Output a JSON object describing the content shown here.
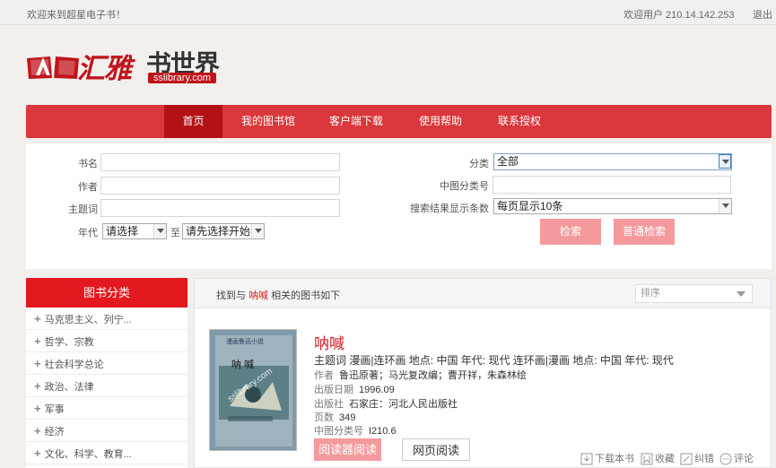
{
  "topbar": {
    "welcome": "欢迎来到超星电子书！",
    "user": "欢迎用户  210.14.142.253",
    "logout": "退出"
  },
  "logo": {
    "name_part1": "汇雅",
    "name_part2": "书世界",
    "url": "sslibrary.com"
  },
  "nav": {
    "items": [
      "首页",
      "我的图书馆",
      "客户端下载",
      "使用帮助",
      "联系授权"
    ]
  },
  "search": {
    "labels": {
      "title": "书名",
      "author": "作者",
      "subject": "主题词",
      "year": "年代",
      "to": "至",
      "category": "分类",
      "clc": "中图分类号",
      "per_page": "搜索结果显示条数"
    },
    "year_from": "请选择",
    "year_to": "请先选择开始年",
    "category_value": "全部",
    "per_page_value": "每页显示10条",
    "search_button": "检索",
    "normal_search_button": "普通检索"
  },
  "sidebar": {
    "title": "图书分类",
    "categories": [
      "马克思主义、列宁...",
      "哲学、宗教",
      "社会科学总论",
      "政治、法律",
      "军事",
      "经济",
      "文化、科学、教育..."
    ]
  },
  "results": {
    "found_prefix": "找到与",
    "keyword": "呐喊",
    "found_suffix": "相关的图书如下",
    "sort_placeholder": "排序",
    "book": {
      "title": "呐喊",
      "subject": "主题词 漫画|连环画 地点: 中国 年代: 现代 连环画|漫画 地点: 中国 年代: 现代",
      "author_label": "作者",
      "author": "鲁迅原著；马光复改编；曹开祥，朱森林绘",
      "date_label": "出版日期",
      "date": "1996.09",
      "publisher_label": "出版社",
      "publisher": "石家庄：河北人民出版社",
      "pages_label": "页数",
      "pages": "349",
      "clc_label": "中图分类号",
      "clc": "I210.6",
      "cover_text": "呐  喊",
      "cover_series": "漫画鲁迅小说",
      "cover_watermark": "sslibrary.com"
    },
    "read_client": "阅读器阅读",
    "read_web": "网页阅读",
    "actions": {
      "download": "下载本书",
      "favorite": "收藏",
      "report": "纠错",
      "comment": "评论"
    }
  },
  "colors": {
    "brand_red": "#d9373b",
    "nav_active": "#b21116",
    "button_pink": "#f59a9c"
  }
}
